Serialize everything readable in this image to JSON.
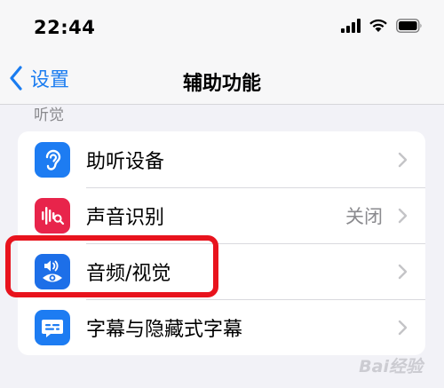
{
  "status_bar": {
    "time": "22:44",
    "icons": [
      "cellular-signal-icon",
      "wifi-icon",
      "battery-icon"
    ]
  },
  "nav": {
    "back_label": "设置",
    "title": "辅助功能"
  },
  "section": {
    "header": "听觉",
    "items": [
      {
        "label": "助听设备",
        "value": "",
        "icon": "ear-icon",
        "icon_color": "#1d7cf2"
      },
      {
        "label": "声音识别",
        "value": "关闭",
        "icon": "sound-recognition-icon",
        "icon_color": "#e8244b"
      },
      {
        "label": "音频/视觉",
        "value": "",
        "icon": "audio-visual-icon",
        "icon_color": "#1d6fe8"
      },
      {
        "label": "字幕与隐藏式字幕",
        "value": "",
        "icon": "subtitles-icon",
        "icon_color": "#1d7cf2"
      }
    ]
  },
  "colors": {
    "accent": "#1a7cf0",
    "highlight": "#e8131d",
    "background": "#f2f2f7"
  },
  "watermark": {
    "text": "Bai经验"
  }
}
